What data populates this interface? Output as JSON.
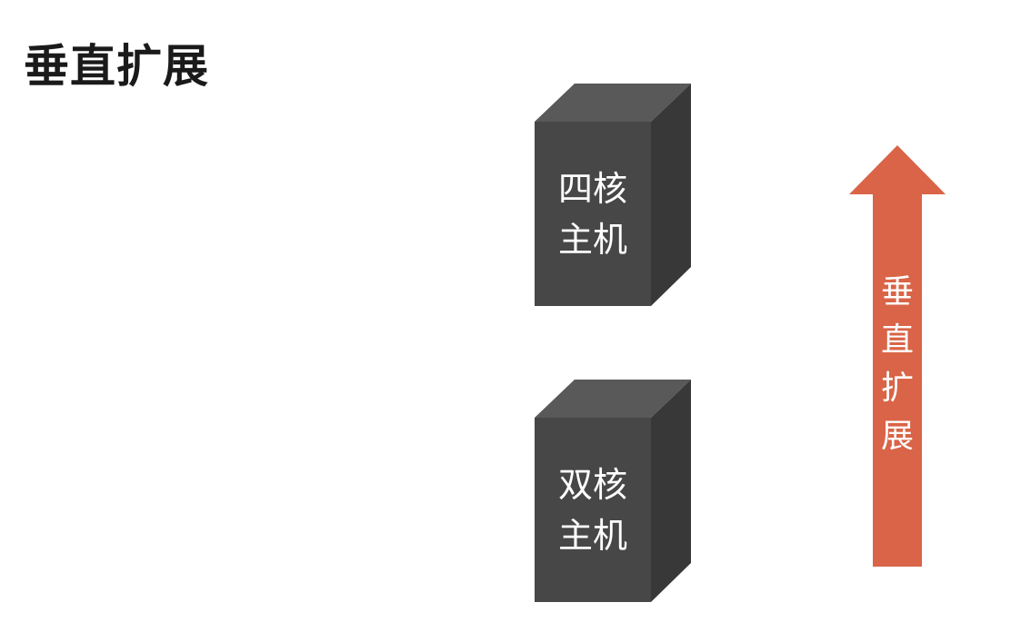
{
  "title": "垂直扩展",
  "hosts": [
    {
      "line1": "四核",
      "line2": "主机"
    },
    {
      "line1": "双核",
      "line2": "主机"
    }
  ],
  "arrow": {
    "chars": [
      "垂",
      "直",
      "扩",
      "展"
    ]
  },
  "colors": {
    "box_front": "#474747",
    "box_top": "#595959",
    "box_side": "#383838",
    "arrow": "#D96447"
  }
}
